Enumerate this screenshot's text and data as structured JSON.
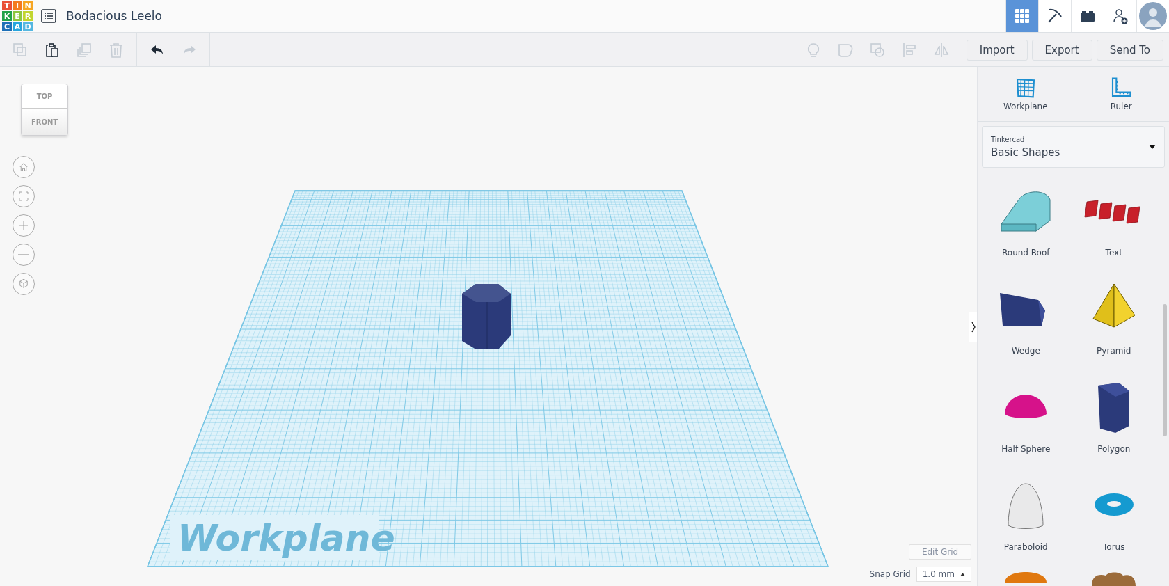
{
  "logo": {
    "letters": [
      "T",
      "I",
      "N",
      "K",
      "E",
      "R",
      "C",
      "A",
      "D"
    ]
  },
  "design_title": "Bodacious Leelo",
  "header_actions": [
    {
      "kind": "grid",
      "selected": true
    },
    {
      "kind": "pickaxe",
      "selected": false
    },
    {
      "kind": "brick",
      "selected": false
    },
    {
      "kind": "add-user",
      "selected": false
    },
    {
      "kind": "avatar",
      "selected": false
    }
  ],
  "edit_tools": [
    {
      "kind": "copy",
      "disabled": true
    },
    {
      "kind": "paste",
      "disabled": false
    },
    {
      "kind": "duplicate",
      "disabled": true
    },
    {
      "kind": "delete",
      "disabled": true
    }
  ],
  "history_tools": [
    {
      "kind": "undo",
      "disabled": false
    },
    {
      "kind": "redo",
      "disabled": true
    }
  ],
  "shape_tools": [
    {
      "kind": "bulb",
      "disabled": true
    },
    {
      "kind": "note",
      "disabled": true
    },
    {
      "kind": "group",
      "disabled": true
    },
    {
      "kind": "align",
      "disabled": true
    },
    {
      "kind": "mirror",
      "disabled": true
    }
  ],
  "file_buttons": [
    "Import",
    "Export",
    "Send To"
  ],
  "view_cube": {
    "top": "TOP",
    "front": "FRONT"
  },
  "nav_buttons": [
    {
      "kind": "home"
    },
    {
      "kind": "fit"
    },
    {
      "kind": "zoom-in"
    },
    {
      "kind": "zoom-out"
    },
    {
      "kind": "perspective"
    }
  ],
  "workplane_label": "Workplane",
  "edit_grid": "Edit Grid",
  "snap_grid": {
    "label": "Snap Grid",
    "value": "1.0 mm"
  },
  "panel_tools": [
    {
      "kind": "workplane",
      "label": "Workplane"
    },
    {
      "kind": "ruler",
      "label": "Ruler"
    }
  ],
  "library": {
    "source": "Tinkercad",
    "value": "Basic Shapes"
  },
  "shapes": [
    {
      "kind": "round-roof",
      "name": "Round Roof"
    },
    {
      "kind": "text",
      "name": "Text"
    },
    {
      "kind": "wedge",
      "name": "Wedge"
    },
    {
      "kind": "pyramid",
      "name": "Pyramid"
    },
    {
      "kind": "half-sphere",
      "name": "Half Sphere"
    },
    {
      "kind": "polygon",
      "name": "Polygon"
    },
    {
      "kind": "paraboloid",
      "name": "Paraboloid"
    },
    {
      "kind": "torus",
      "name": "Torus"
    },
    {
      "kind": "orange-partial"
    },
    {
      "kind": "brown-partial"
    }
  ]
}
